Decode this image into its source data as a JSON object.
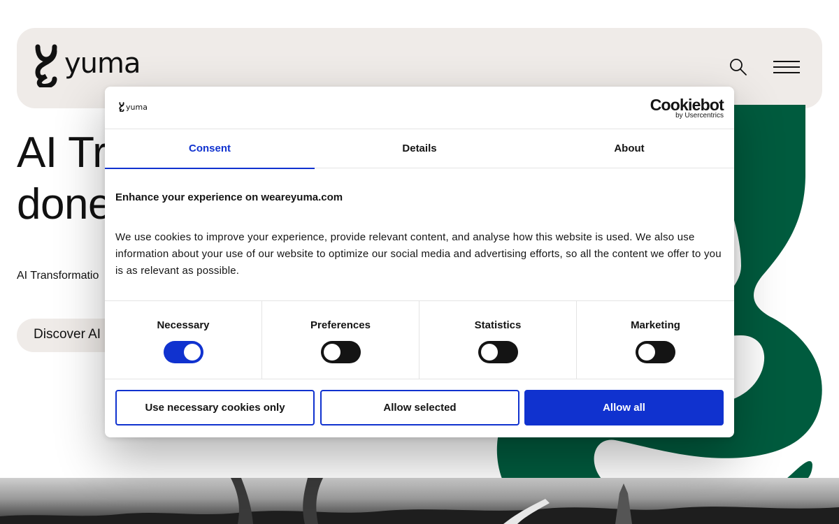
{
  "site": {
    "logo_text": "yuma",
    "hero_title_line1": "AI Tr",
    "hero_title_line2": "done",
    "hero_subtitle": "AI Transformatio",
    "cta_label": "Discover AI"
  },
  "dialog": {
    "brand": "yuma",
    "cookiebot_name": "Cookiebot",
    "cookiebot_by": "by Usercentrics",
    "tabs": [
      {
        "label": "Consent",
        "active": true
      },
      {
        "label": "Details",
        "active": false
      },
      {
        "label": "About",
        "active": false
      }
    ],
    "title": "Enhance your experience on weareyuma.com",
    "body": "We use cookies to improve your experience, provide relevant content, and analyse how this website is used. We also use information about your use of our website to optimize our social media and advertising efforts, so all the content we offer to you is as relevant as possible.",
    "toggles": [
      {
        "label": "Necessary",
        "on": true
      },
      {
        "label": "Preferences",
        "on": false
      },
      {
        "label": "Statistics",
        "on": false
      },
      {
        "label": "Marketing",
        "on": false
      }
    ],
    "buttons": {
      "necessary_only": "Use necessary cookies only",
      "allow_selected": "Allow selected",
      "allow_all": "Allow all"
    }
  },
  "icons": {
    "search": "search-icon",
    "menu": "hamburger-menu-icon"
  },
  "colors": {
    "accent": "#1032cf",
    "brand_green": "#005b3e",
    "header_bg": "#efebe8"
  }
}
